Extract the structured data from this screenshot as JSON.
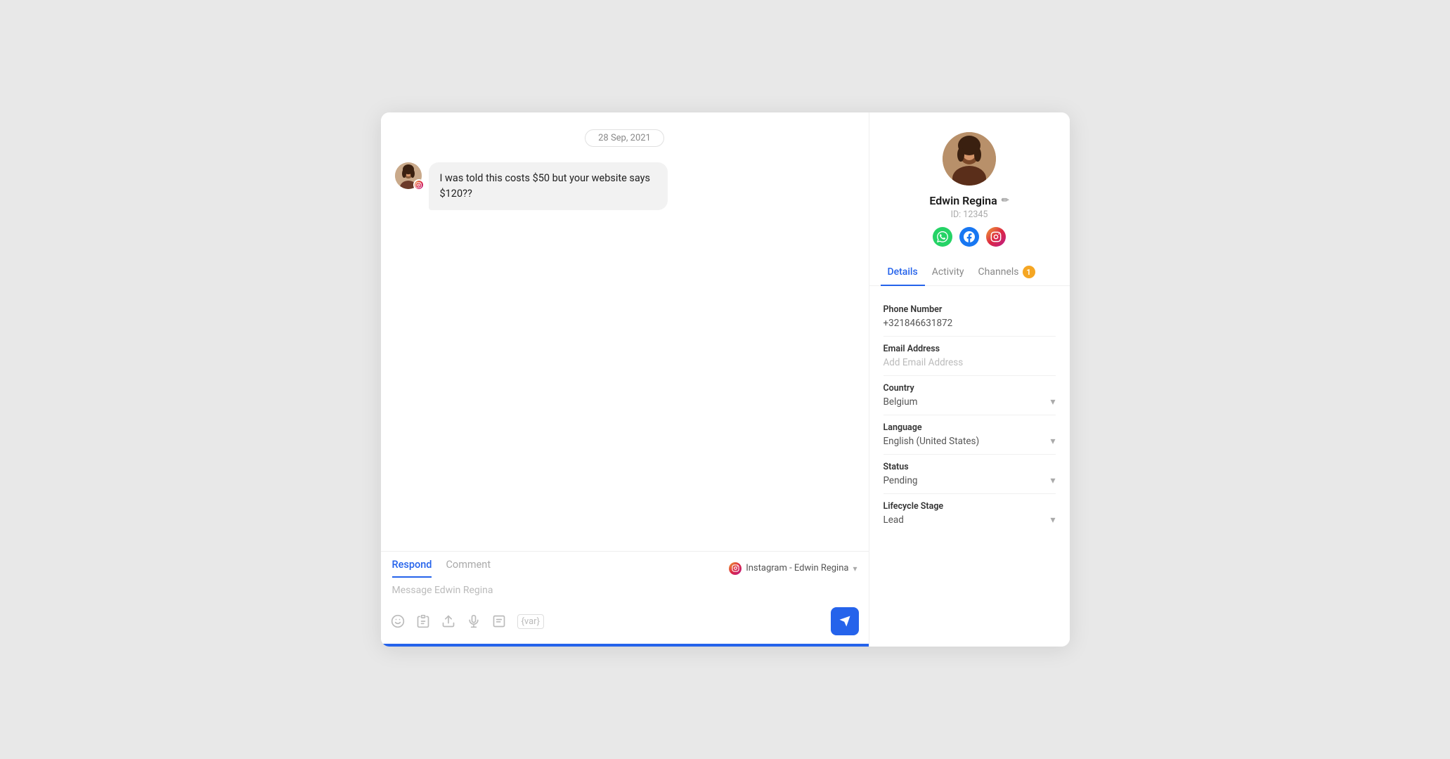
{
  "chat": {
    "date_badge": "28 Sep, 2021",
    "message": "I was told this costs $50 but your website says $120??",
    "composer": {
      "tab_respond": "Respond",
      "tab_comment": "Comment",
      "channel_label": "Instagram - Edwin Regina",
      "input_placeholder": "Message Edwin Regina",
      "toolbar_icons": [
        "emoji",
        "clipboard",
        "upload",
        "microphone",
        "note",
        "variable"
      ],
      "send_label": "Send"
    }
  },
  "contact": {
    "name": "Edwin Regina",
    "id_label": "ID: 12345",
    "tabs": [
      {
        "label": "Details",
        "active": true,
        "badge": null
      },
      {
        "label": "Activity",
        "active": false,
        "badge": null
      },
      {
        "label": "Channels",
        "active": false,
        "badge": "1"
      }
    ],
    "fields": [
      {
        "label": "Phone Number",
        "value": "+321846631872",
        "type": "text",
        "placeholder": false
      },
      {
        "label": "Email Address",
        "value": "Add Email Address",
        "type": "text",
        "placeholder": true
      },
      {
        "label": "Country",
        "value": "Belgium",
        "type": "select",
        "placeholder": false
      },
      {
        "label": "Language",
        "value": "English (United States)",
        "type": "select",
        "placeholder": false
      },
      {
        "label": "Status",
        "value": "Pending",
        "type": "select",
        "placeholder": false
      },
      {
        "label": "Lifecycle Stage",
        "value": "Lead",
        "type": "select",
        "placeholder": false
      }
    ]
  }
}
